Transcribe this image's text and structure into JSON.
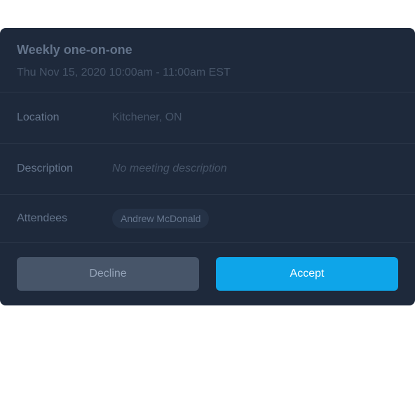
{
  "event": {
    "title": "Weekly one-on-one",
    "datetime": "Thu Nov 15, 2020 10:00am - 11:00am EST"
  },
  "details": {
    "location_label": "Location",
    "location_value": "Kitchener, ON",
    "description_label": "Description",
    "description_value": "No meeting description",
    "attendees_label": "Attendees",
    "attendees": [
      "Andrew McDonald"
    ]
  },
  "actions": {
    "decline_label": "Decline",
    "accept_label": "Accept"
  },
  "colors": {
    "card_bg": "#1e293b",
    "accept_bg": "#0ea5e9",
    "decline_bg": "#475569"
  }
}
